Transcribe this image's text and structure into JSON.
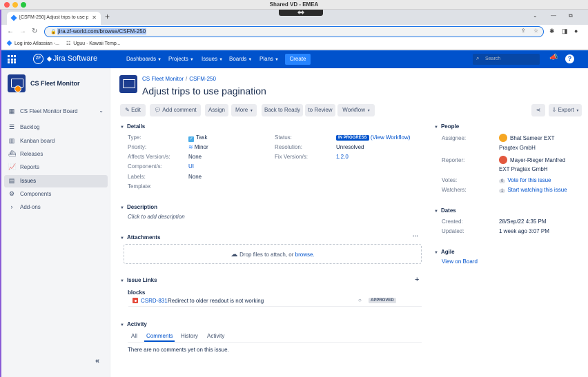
{
  "os": {
    "window_title": "Shared VD - EMEA"
  },
  "browser": {
    "tab_title": "[CSFM-250] Adjust trips to use pa",
    "url": "jira.zf-world.com/browse/CSFM-250",
    "bookmarks": [
      "Log into Atlassian -...",
      "Uguu · Kawaii Temp..."
    ]
  },
  "jira_nav": {
    "brand": "Jira Software",
    "logo_text": "ZF",
    "items": [
      "Dashboards",
      "Projects",
      "Issues",
      "Boards",
      "Plans"
    ],
    "create_label": "Create",
    "search_placeholder": "Search",
    "help_label": "?",
    "colors": {
      "nav_bg": "#0052cc",
      "create_bg": "#2684ff"
    }
  },
  "sidebar": {
    "project_name": "CS Fleet Monitor",
    "board_selector": "CS Fleet Monitor Board",
    "items": [
      {
        "label": "Backlog",
        "icon": "backlog-icon",
        "glyph": "☰"
      },
      {
        "label": "Kanban board",
        "icon": "kanban-icon",
        "glyph": "▥"
      },
      {
        "label": "Releases",
        "icon": "ship-icon",
        "glyph": "⛴"
      },
      {
        "label": "Reports",
        "icon": "reports-icon",
        "glyph": "📈"
      },
      {
        "label": "Issues",
        "icon": "issues-icon",
        "glyph": "▤",
        "active": true
      },
      {
        "label": "Components",
        "icon": "components-icon",
        "glyph": "⚙"
      },
      {
        "label": "Add-ons",
        "icon": "chevron-right-icon",
        "glyph": "›"
      }
    ],
    "collapse_glyph": "«"
  },
  "issue": {
    "breadcrumb_project": "CS Fleet Monitor",
    "breadcrumb_key": "CSFM-250",
    "title": "Adjust trips to use pagination"
  },
  "toolbar": {
    "edit": "Edit",
    "add_comment": "Add comment",
    "assign": "Assign",
    "more": "More",
    "back_to_ready": "Back to Ready",
    "to_review": "to Review",
    "workflow": "Workflow",
    "export": "Export"
  },
  "details": {
    "heading": "Details",
    "type_label": "Type:",
    "type_value": "Task",
    "priority_label": "Priority:",
    "priority_value": "Minor",
    "affects_label": "Affects Version/s:",
    "affects_value": "None",
    "component_label": "Component/s:",
    "component_value": "UI",
    "labels_label": "Labels:",
    "labels_value": "None",
    "template_label": "Template:",
    "status_label": "Status:",
    "status_value": "IN PROGRESS",
    "view_workflow": "(View Workflow)",
    "resolution_label": "Resolution:",
    "resolution_value": "Unresolved",
    "fix_label": "Fix Version/s:",
    "fix_value": "1.2.0"
  },
  "description": {
    "heading": "Description",
    "placeholder": "Click to add description"
  },
  "attachments": {
    "heading": "Attachments",
    "drop_text": "Drop files to attach, or",
    "browse": "browse."
  },
  "issue_links": {
    "heading": "Issue Links",
    "relation": "blocks",
    "links": [
      {
        "key": "CSRD-831",
        "summary": "Redirect to older readout is not working",
        "status": "APPROVED"
      }
    ]
  },
  "activity": {
    "heading": "Activity",
    "tabs": [
      "All",
      "Comments",
      "History",
      "Activity"
    ],
    "selected_tab": "Comments",
    "empty": "There are no comments yet on this issue."
  },
  "people": {
    "heading": "People",
    "assignee_label": "Assignee:",
    "assignee_line1": "Bhat Sameer EXT",
    "assignee_line2": "Pragtex GmbH",
    "reporter_label": "Reporter:",
    "reporter_line1": "Mayer-Rieger Manfred",
    "reporter_line2": "EXT Pragtex GmbH",
    "votes_label": "Votes:",
    "votes_count": "0",
    "votes_link": "Vote for this issue",
    "watchers_label": "Watchers:",
    "watchers_count": "1",
    "watchers_link": "Start watching this issue"
  },
  "dates": {
    "heading": "Dates",
    "created_label": "Created:",
    "created_value": "28/Sep/22 4:35 PM",
    "updated_label": "Updated:",
    "updated_value": "1 week ago 3:07 PM"
  },
  "agile": {
    "heading": "Agile",
    "view_on_board": "View on Board"
  }
}
